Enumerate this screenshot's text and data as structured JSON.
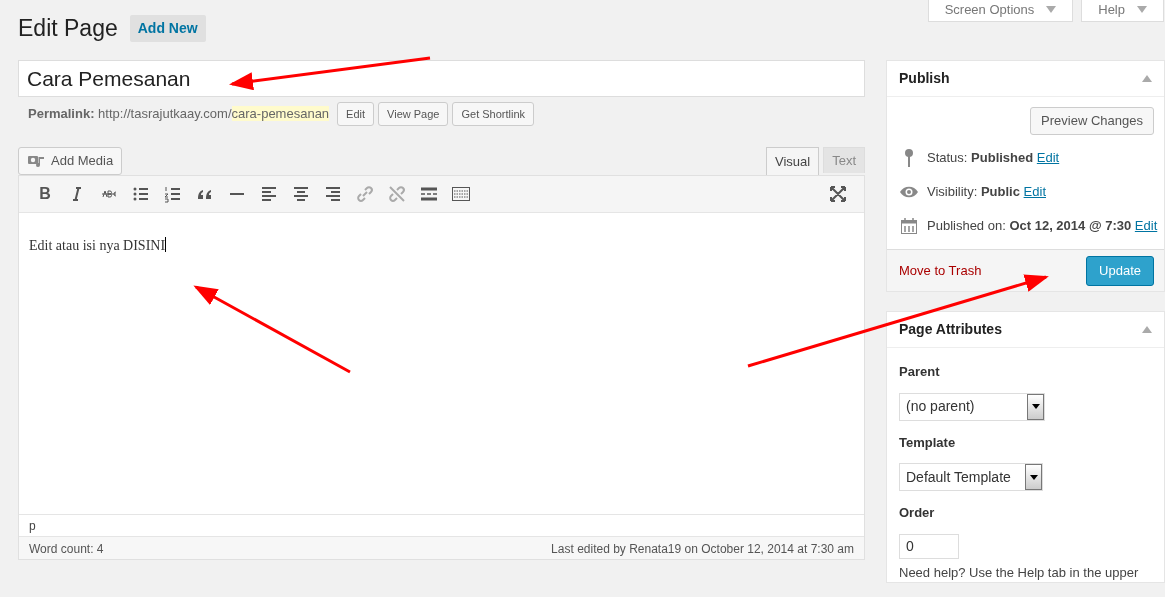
{
  "header": {
    "title": "Edit Page",
    "add_new": "Add New"
  },
  "top_tabs": [
    {
      "label": "Screen Options"
    },
    {
      "label": "Help"
    }
  ],
  "post_title": "Cara Pemesanan",
  "permalink": {
    "label": "Permalink:",
    "base": "http://tasrajutkaay.com/",
    "slug": "cara-pemesanan",
    "buttons": [
      "Edit",
      "View Page",
      "Get Shortlink"
    ]
  },
  "add_media": "Add Media",
  "editor_tabs": [
    {
      "label": "Visual",
      "selected": true
    },
    {
      "label": "Text",
      "selected": false
    }
  ],
  "toolbar_bold": "B",
  "content": "Edit atau isi nya DISINI",
  "path": "p",
  "word_count": "Word count: 4",
  "last_edited": "Last edited by Renata19 on October 12, 2014 at 7:30 am",
  "publish": {
    "title": "Publish",
    "preview": "Preview Changes",
    "rows": [
      {
        "kind": "status",
        "label": "Status:",
        "value": "Published",
        "link": "Edit"
      },
      {
        "kind": "visibility",
        "label": "Visibility:",
        "value": "Public",
        "link": "Edit"
      },
      {
        "kind": "date",
        "label": "Published on:",
        "value": "Oct 12, 2014 @ 7:30",
        "link": "Edit"
      }
    ],
    "trash": "Move to Trash",
    "update": "Update"
  },
  "attributes": {
    "title": "Page Attributes",
    "parent_label": "Parent",
    "parent": "(no parent)",
    "template_label": "Template",
    "template": "Default Template",
    "order_label": "Order",
    "order": "0",
    "help": "Need help? Use the Help tab in the upper"
  }
}
